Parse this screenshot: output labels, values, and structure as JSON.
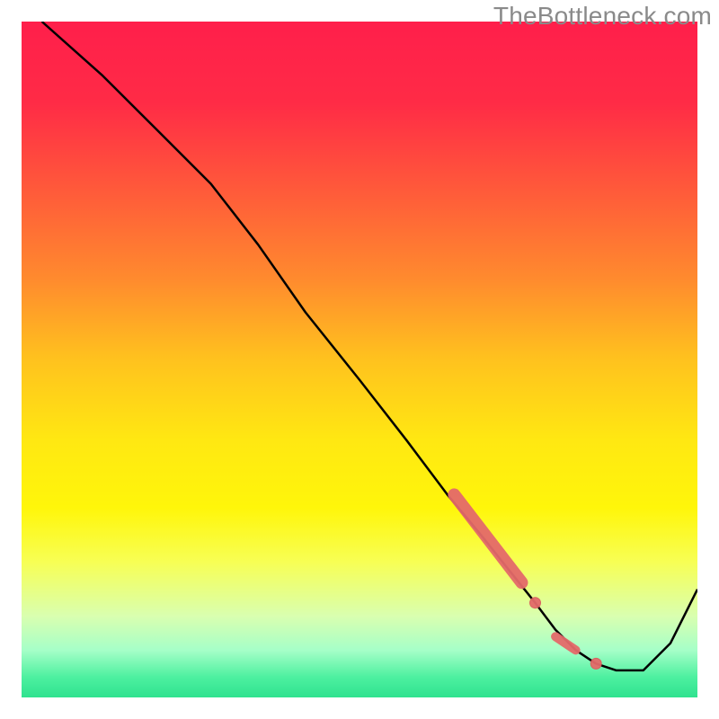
{
  "watermark": "TheBottleneck.com",
  "colors": {
    "gradient_stops": [
      {
        "offset": 0.0,
        "color": "#ff1f4b"
      },
      {
        "offset": 0.12,
        "color": "#ff2b46"
      },
      {
        "offset": 0.25,
        "color": "#ff5a3a"
      },
      {
        "offset": 0.38,
        "color": "#ff8a2e"
      },
      {
        "offset": 0.5,
        "color": "#ffc21e"
      },
      {
        "offset": 0.62,
        "color": "#ffe812"
      },
      {
        "offset": 0.72,
        "color": "#fff60a"
      },
      {
        "offset": 0.8,
        "color": "#f7ff55"
      },
      {
        "offset": 0.88,
        "color": "#d9ffb0"
      },
      {
        "offset": 0.93,
        "color": "#a6ffc8"
      },
      {
        "offset": 0.97,
        "color": "#4df0a0"
      },
      {
        "offset": 1.0,
        "color": "#2fe28f"
      }
    ],
    "curve": "#000000",
    "marker_fill": "#e46a6a",
    "marker_stroke": "#d95c5c",
    "frame": "#ffffff"
  },
  "chart_data": {
    "type": "line",
    "title": "",
    "xlabel": "",
    "ylabel": "",
    "xlim": [
      0,
      100
    ],
    "ylim": [
      0,
      100
    ],
    "grid": false,
    "legend": false,
    "annotations": [
      "TheBottleneck.com"
    ],
    "series": [
      {
        "name": "bottleneck-curve",
        "x": [
          3,
          12,
          20,
          28,
          35,
          42,
          50,
          57,
          63,
          68,
          72,
          76,
          79,
          82,
          85,
          88,
          92,
          96,
          100
        ],
        "y": [
          100,
          92,
          84,
          76,
          67,
          57,
          47,
          38,
          30,
          24,
          19,
          14,
          10,
          7,
          5,
          4,
          4,
          8,
          16
        ]
      }
    ],
    "markers": [
      {
        "name": "highlighted-segment-thick",
        "shape": "line-segment",
        "x": [
          64,
          74
        ],
        "y": [
          30,
          17
        ],
        "stroke_width": 14
      },
      {
        "name": "highlighted-point-mid",
        "shape": "circle",
        "x": 76,
        "y": 14,
        "r": 6
      },
      {
        "name": "highlighted-segment-lower",
        "shape": "line-segment",
        "x": [
          79,
          82
        ],
        "y": [
          9,
          7
        ],
        "stroke_width": 10
      },
      {
        "name": "highlighted-point-low",
        "shape": "circle",
        "x": 85,
        "y": 5,
        "r": 6
      }
    ]
  }
}
